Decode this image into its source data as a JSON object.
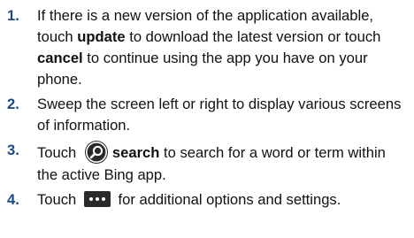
{
  "steps": [
    {
      "number": "1.",
      "parts": [
        "If there is a new version of the application available, touch ",
        "update",
        " to download the latest version or touch ",
        "cancel",
        " to continue using the app you have on your phone."
      ]
    },
    {
      "number": "2.",
      "parts": [
        "Sweep the screen left or right to display various screens of information."
      ]
    },
    {
      "number": "3.",
      "parts": [
        "Touch ",
        "search",
        " to search for a word or term within the active Bing app."
      ],
      "icon": "search-icon"
    },
    {
      "number": "4.",
      "parts": [
        "Touch ",
        " for additional options and settings."
      ],
      "icon": "more-options-icon"
    }
  ],
  "colors": {
    "number": "#1d4a86",
    "icon_bg": "#2a2a2a"
  }
}
